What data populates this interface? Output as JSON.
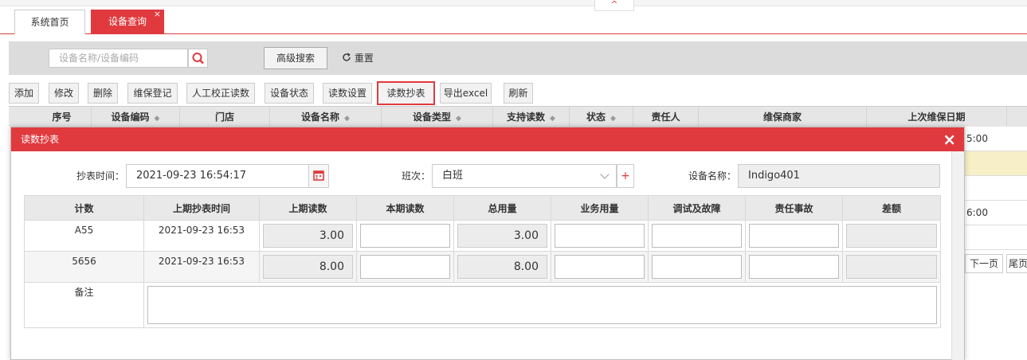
{
  "tabs": [
    {
      "label": "系统首页"
    },
    {
      "label": "设备查询",
      "close": "×"
    }
  ],
  "collapse_glyph": "^",
  "search": {
    "placeholder": "设备名称/设备编码",
    "advanced": "高级搜索",
    "reset": "重置"
  },
  "toolbar": [
    "添加",
    "修改",
    "删除",
    "维保登记",
    "人工校正读数",
    "设备状态",
    "读数设置",
    "读数抄表",
    "导出excel",
    "刷新"
  ],
  "grid_columns": [
    "序号",
    "设备编码",
    "门店",
    "设备名称",
    "设备类型",
    "支持读数",
    "状态",
    "责任人",
    "维保商家",
    "上次维保日期"
  ],
  "grid_right": {
    "row1": "5:00",
    "row4": "6:00",
    "next": "下一页",
    "last": "尾页"
  },
  "modal": {
    "title": "读数抄表",
    "close": "×",
    "time_label": "抄表时间：",
    "time_value": "2021-09-23 16:54:17",
    "shift_label": "班次：",
    "shift_value": "白班",
    "plus": "+",
    "device_label": "设备名称：",
    "device_value": "Indigo401",
    "table": {
      "headers": [
        "计数",
        "上期抄表时间",
        "上期读数",
        "本期读数",
        "总用量",
        "业务用量",
        "调试及故障",
        "责任事故",
        "差额"
      ],
      "rows": [
        {
          "counter": "A55",
          "last_time": "2021-09-23 16:53",
          "last_reading": "3.00",
          "total": "3.00"
        },
        {
          "counter": "5656",
          "last_time": "2021-09-23 16:53",
          "last_reading": "8.00",
          "total": "8.00"
        }
      ],
      "remark_label": "备注"
    }
  },
  "colors": {
    "accent": "#e03a3e"
  }
}
